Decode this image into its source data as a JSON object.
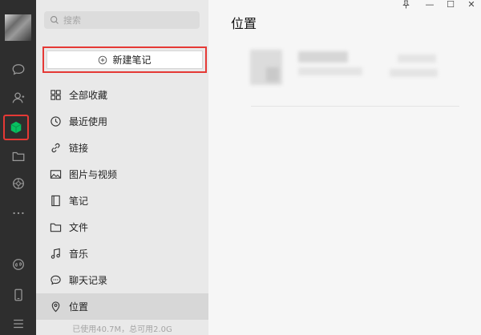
{
  "search": {
    "placeholder": "搜索"
  },
  "toolbar": {
    "new_note_label": "新建笔记"
  },
  "nav": {
    "items": [
      {
        "label": "全部收藏",
        "icon": "grid-icon"
      },
      {
        "label": "最近使用",
        "icon": "clock-icon"
      },
      {
        "label": "链接",
        "icon": "link-icon"
      },
      {
        "label": "图片与视频",
        "icon": "image-icon"
      },
      {
        "label": "笔记",
        "icon": "notebook-icon"
      },
      {
        "label": "文件",
        "icon": "folder-icon"
      },
      {
        "label": "音乐",
        "icon": "music-icon"
      },
      {
        "label": "聊天记录",
        "icon": "chat-icon"
      },
      {
        "label": "位置",
        "icon": "location-icon"
      }
    ],
    "active": "位置"
  },
  "storage": {
    "text": "已使用40.7M，总可用2.0G"
  },
  "main": {
    "title": "位置"
  },
  "window": {
    "pin": "pin-icon",
    "minimize": "—",
    "maximize": "☐",
    "close": "✕"
  },
  "colors": {
    "rail_bg": "#2e2e2e",
    "accent_green": "#07c160",
    "highlight_red": "#e53935"
  }
}
